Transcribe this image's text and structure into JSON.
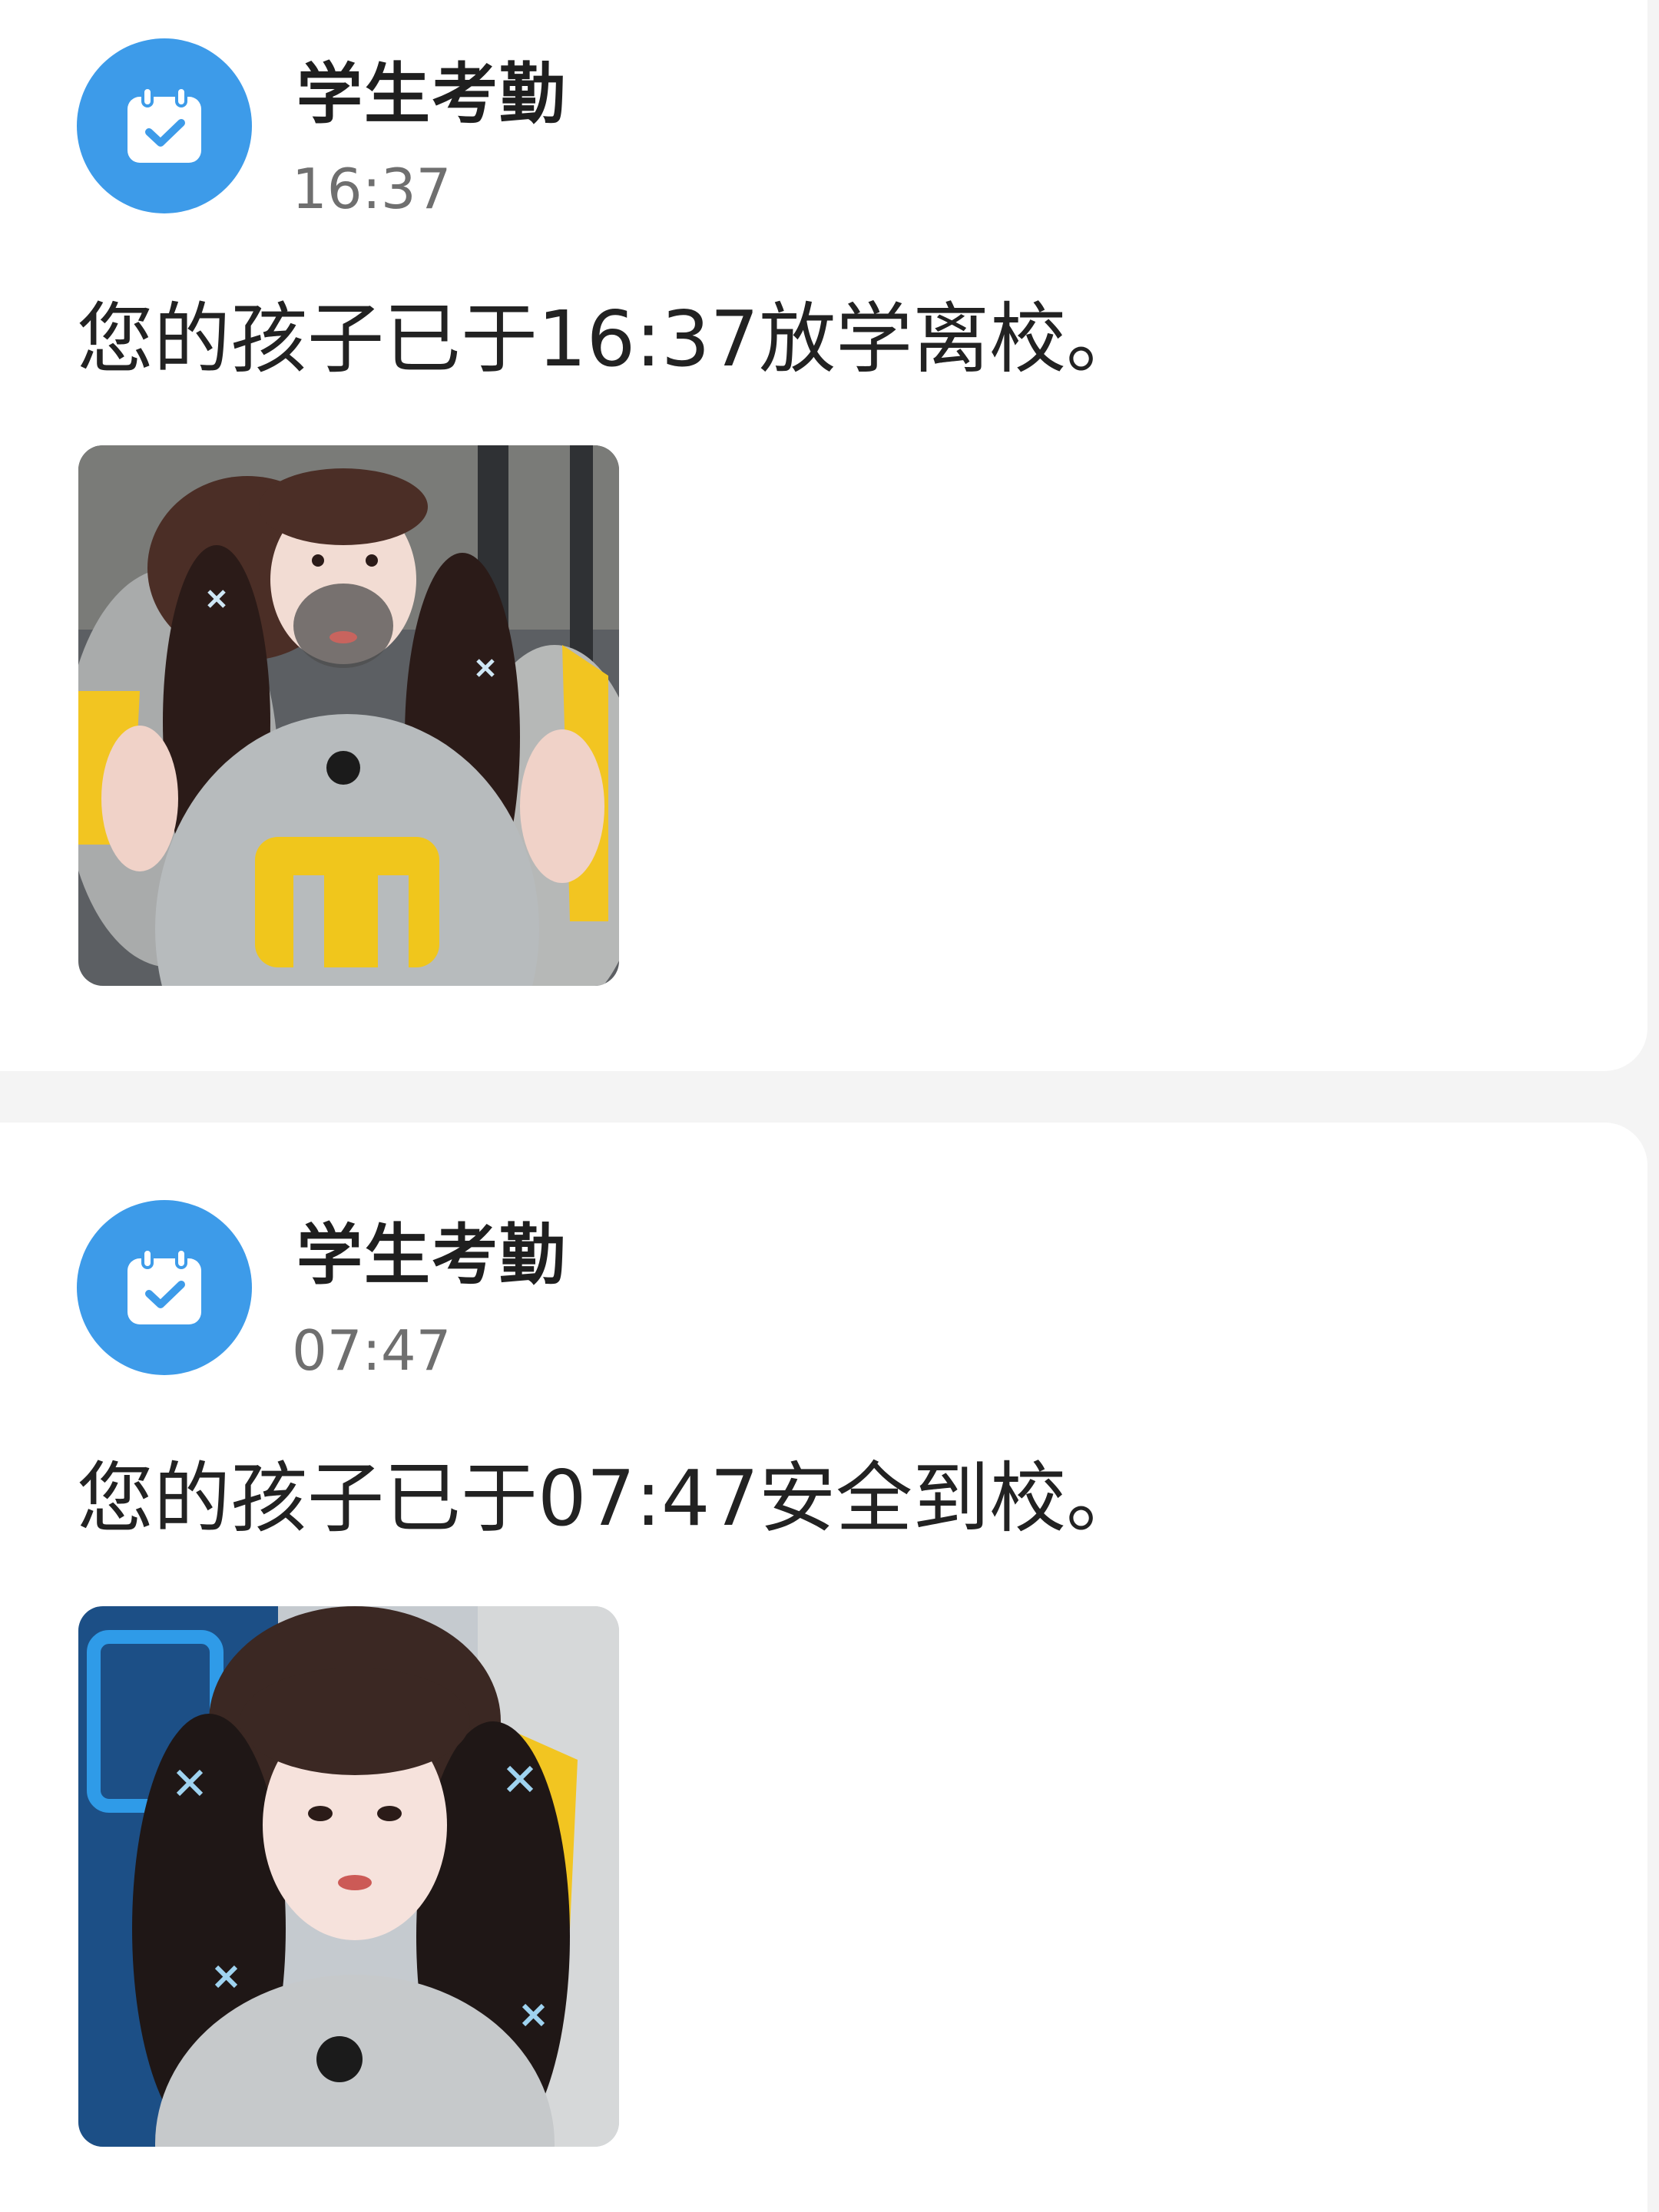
{
  "notifications": [
    {
      "app_name": "学生考勤",
      "time": "16:37",
      "message": "您的孩子已于16:37放学离校。",
      "icon": "calendar-check-icon",
      "photo": "attendance-photo"
    },
    {
      "app_name": "学生考勤",
      "time": "07:47",
      "message": "您的孩子已于07:47安全到校。",
      "icon": "calendar-check-icon",
      "photo": "attendance-photo"
    }
  ],
  "colors": {
    "icon_bg": "#3d9be9",
    "page_bg": "#f4f4f4",
    "card_bg": "#ffffff"
  }
}
